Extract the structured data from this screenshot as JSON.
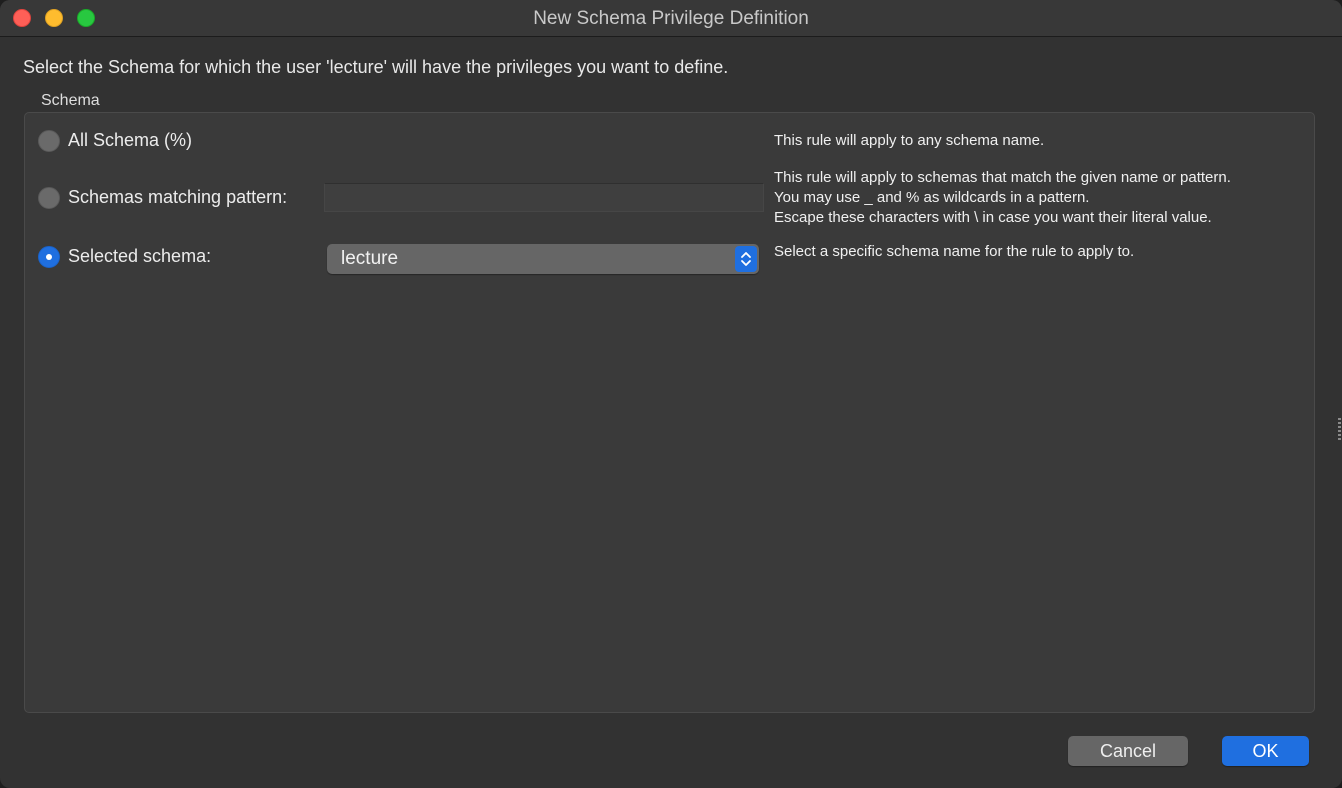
{
  "window": {
    "title": "New Schema Privilege Definition"
  },
  "instruction": "Select the Schema for which the user 'lecture' will have the privileges you want to define.",
  "group": {
    "label": "Schema",
    "options": [
      {
        "label": "All Schema (%)",
        "selected": false,
        "description": [
          "This rule will apply to any schema name."
        ]
      },
      {
        "label": "Schemas matching pattern:",
        "selected": false,
        "input_value": "",
        "description": [
          "This rule will apply to schemas that match the given name or pattern.",
          "You may use _ and % as wildcards in a pattern.",
          "Escape these characters with \\ in case you want their literal value."
        ]
      },
      {
        "label": "Selected schema:",
        "selected": true,
        "select_value": "lecture",
        "description": [
          "Select a specific schema name for the rule to apply to."
        ]
      }
    ]
  },
  "buttons": {
    "cancel": "Cancel",
    "ok": "OK"
  },
  "colors": {
    "accent": "#1f6fe0",
    "window_bg": "#323232",
    "close": "#fe5f57",
    "minimize": "#febc2e",
    "maximize": "#28c840"
  }
}
